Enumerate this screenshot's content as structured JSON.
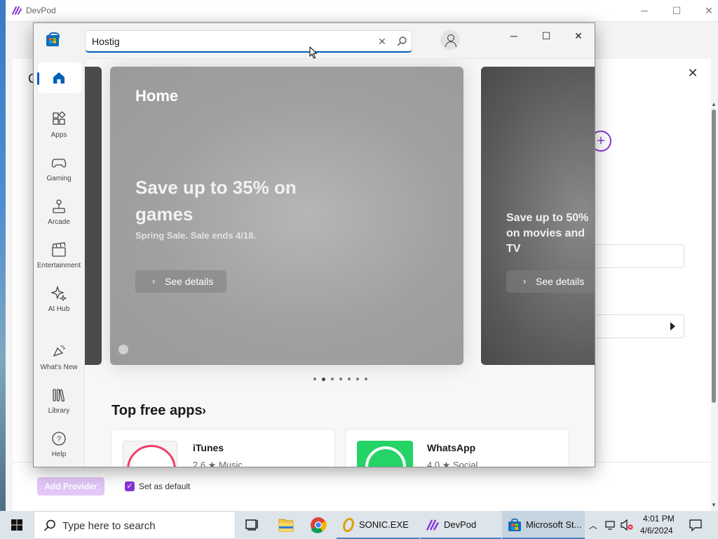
{
  "devpod": {
    "title": "DevPod",
    "partial_letter": "C",
    "add_provider_label": "Add Provider",
    "set_default_label": "Set as default"
  },
  "store": {
    "search": {
      "value": "Hostig"
    },
    "nav": [
      {
        "label": "Home",
        "icon": "home-icon"
      },
      {
        "label": "Apps",
        "icon": "apps-icon"
      },
      {
        "label": "Gaming",
        "icon": "gamepad-icon"
      },
      {
        "label": "Arcade",
        "icon": "joystick-icon"
      },
      {
        "label": "Entertainment",
        "icon": "clapperboard-icon"
      },
      {
        "label": "AI Hub",
        "icon": "sparkle-icon"
      },
      {
        "label": "What's New",
        "icon": "megaphone-icon"
      },
      {
        "label": "Library",
        "icon": "library-icon"
      },
      {
        "label": "Help",
        "icon": "help-icon"
      }
    ],
    "hero": {
      "title": "Home",
      "promo": "Save up to 35% on games",
      "promo_sub": "Spring Sale. Sale ends 4/18.",
      "see_details": "See details",
      "next_promo": "Save up to 50% on movies and TV",
      "next_see_details": "See details",
      "dots_count": 7,
      "active_dot": 1
    },
    "section_title": "Top free apps",
    "apps": [
      {
        "name": "iTunes",
        "rating": "2.6 ★",
        "category": "Music",
        "meta": "2.6 ★   Music"
      },
      {
        "name": "WhatsApp",
        "rating": "4.0 ★",
        "category": "Social",
        "meta": "4.0 ★   Social"
      }
    ]
  },
  "taskbar": {
    "search_placeholder": "Type here to search",
    "apps": [
      {
        "label": "SONIC.EXE"
      },
      {
        "label": "DevPod"
      },
      {
        "label": "Microsoft St..."
      }
    ],
    "time": "4:01 PM",
    "date": "4/6/2024"
  },
  "colors": {
    "accent": "#005fb8",
    "devpod_purple": "#8a35d8",
    "taskbar": "#dde4ea"
  }
}
